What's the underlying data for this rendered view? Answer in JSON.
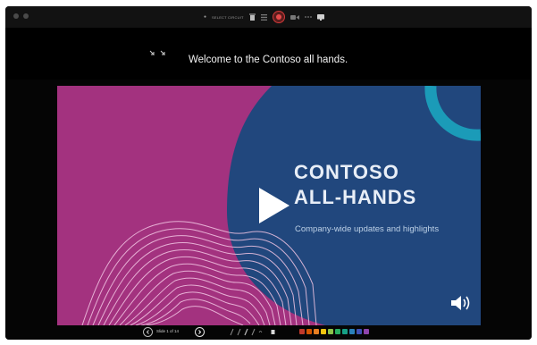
{
  "toolbar": {
    "record_label": "SELECT CIRCUIT",
    "icons": [
      "trash-icon",
      "list-icon",
      "record-icon",
      "more-icon",
      "grid-icon",
      "screen-icon"
    ]
  },
  "caption": {
    "text": "Welcome to the Contoso all hands."
  },
  "slide": {
    "title": "CONTOSO\nALL-HANDS",
    "subtitle": "Company-wide updates and highlights",
    "colors": {
      "magenta": "#a3327f",
      "blue": "#21477d",
      "teal": "#1b9bb8"
    }
  },
  "bottombar": {
    "slide_counter": "Slide 1 of 14",
    "ink_colors": [
      "#c0392b",
      "#d35400",
      "#e67e22",
      "#f1c40f",
      "#8bc34a",
      "#27ae60",
      "#16a085",
      "#2980b9",
      "#3f51b5",
      "#8e44ad"
    ]
  }
}
